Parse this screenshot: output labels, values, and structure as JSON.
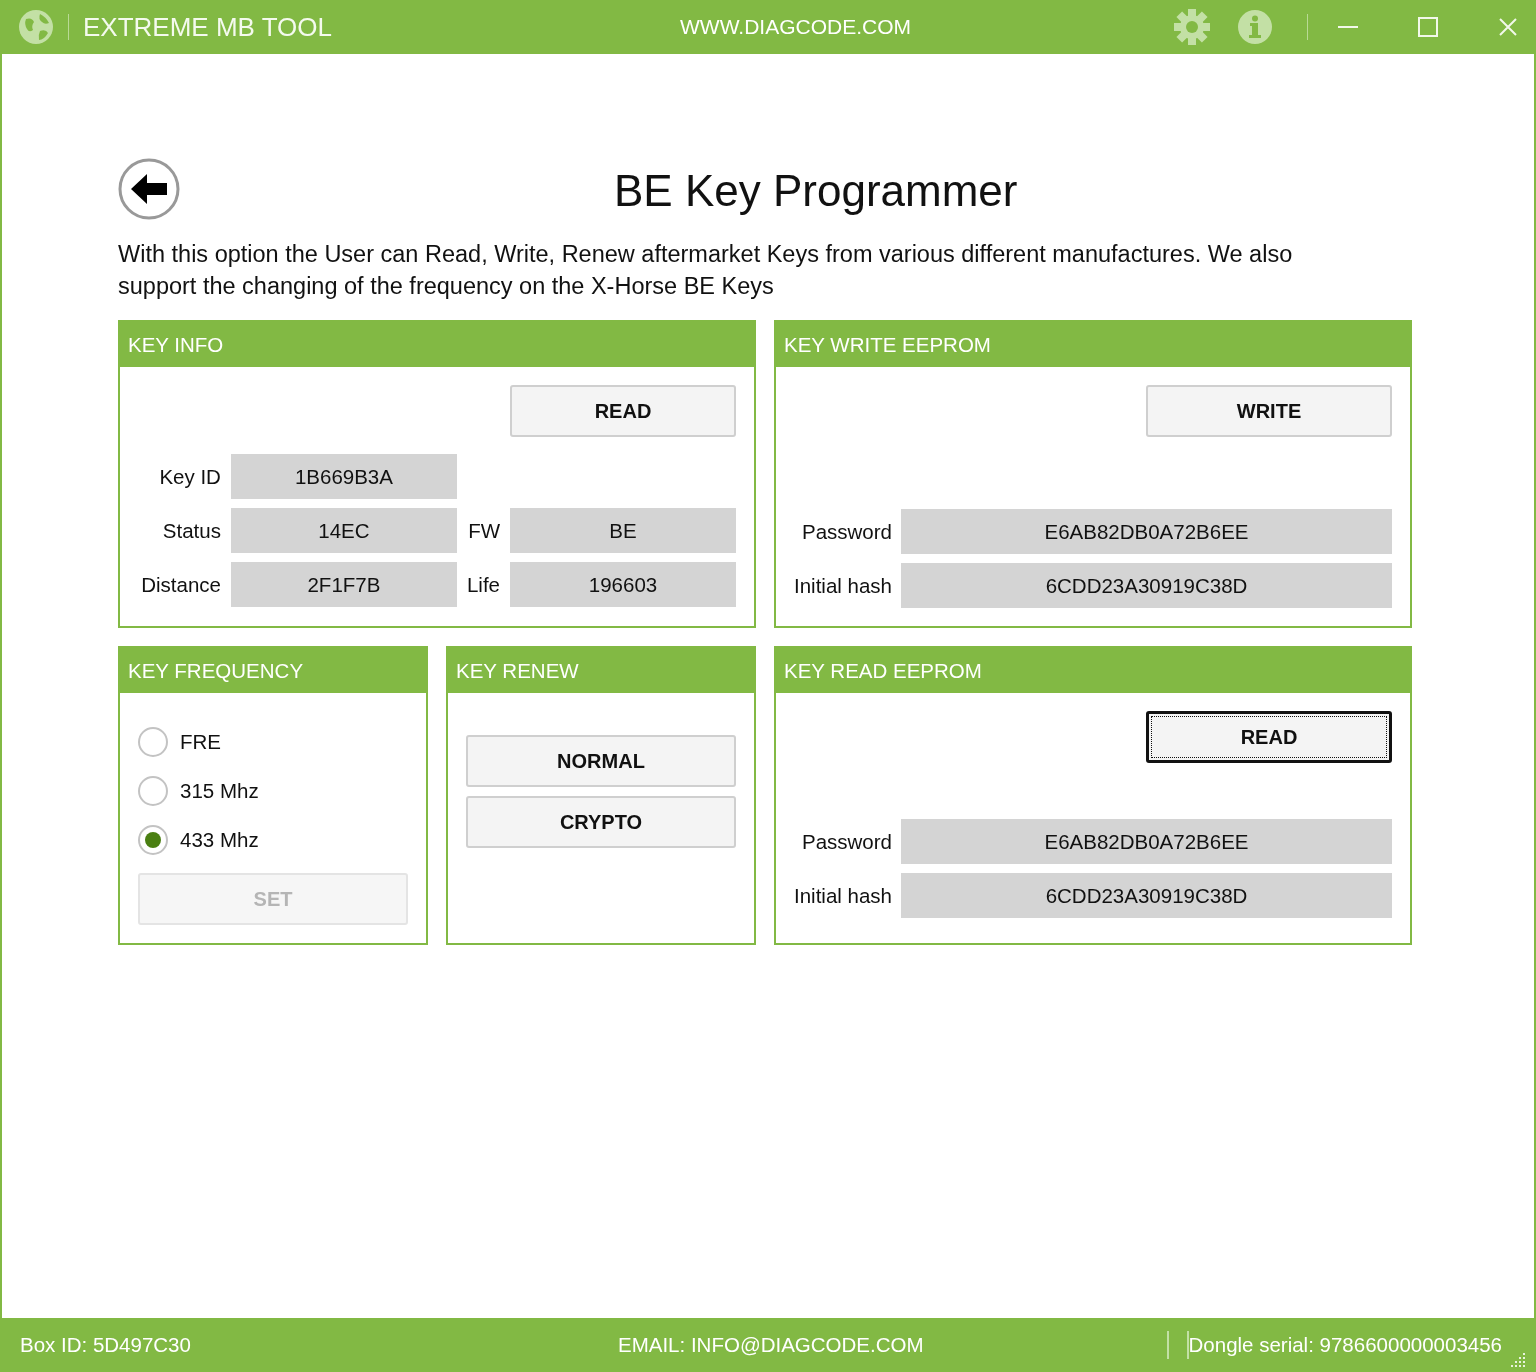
{
  "window": {
    "title": "EXTREME MB TOOL",
    "website": "WWW.DIAGCODE.COM"
  },
  "page": {
    "title": "BE Key Programmer",
    "description": "With this option the User can Read, Write, Renew aftermarket Keys from various different manufactures. We also support the changing of the frequency on the X-Horse BE Keys"
  },
  "key_info": {
    "title": "KEY INFO",
    "button": {
      "label": "READ",
      "disabled": false,
      "focused": false
    },
    "rows": [
      [
        {
          "label": "Key ID",
          "value": "1B669B3A"
        }
      ],
      [
        {
          "label": "Status",
          "value": "14EC"
        },
        {
          "label": "FW",
          "value": "BE"
        }
      ],
      [
        {
          "label": "Distance",
          "value": "2F1F7B"
        },
        {
          "label": "Life",
          "value": "196603"
        }
      ]
    ]
  },
  "key_write_eeprom": {
    "title": "KEY WRITE EEPROM",
    "button": {
      "label": "WRITE",
      "disabled": false,
      "focused": false
    },
    "fields": [
      {
        "label": "Password",
        "value": "E6AB82DB0A72B6EE"
      },
      {
        "label": "Initial hash",
        "value": "6CDD23A30919C38D"
      }
    ]
  },
  "key_frequency": {
    "title": "KEY FREQUENCY",
    "options": [
      {
        "label": "FRE",
        "selected": false
      },
      {
        "label": "315 Mhz",
        "selected": false
      },
      {
        "label": "433 Mhz",
        "selected": true
      }
    ],
    "button": {
      "label": "SET",
      "disabled": true,
      "focused": false
    }
  },
  "key_renew": {
    "title": "KEY RENEW",
    "buttons": [
      {
        "label": "NORMAL",
        "disabled": false,
        "focused": false
      },
      {
        "label": "CRYPTO",
        "disabled": false,
        "focused": false
      }
    ]
  },
  "key_read_eeprom": {
    "title": "KEY READ EEPROM",
    "button": {
      "label": "READ",
      "disabled": false,
      "focused": true
    },
    "fields": [
      {
        "label": "Password",
        "value": "E6AB82DB0A72B6EE"
      },
      {
        "label": "Initial hash",
        "value": "6CDD23A30919C38D"
      }
    ]
  },
  "status_bar": {
    "box_id": "Box ID: 5D497C30",
    "email": "EMAIL: INFO@DIAGCODE.COM",
    "dongle_serial": "Dongle serial: 9786600000003456"
  }
}
